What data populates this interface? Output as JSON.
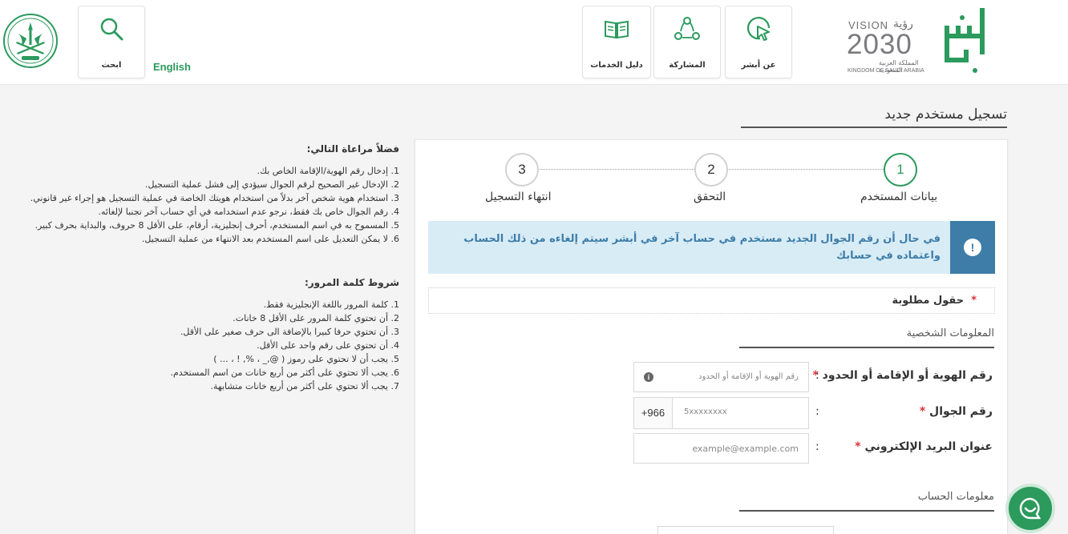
{
  "header": {
    "search_label": "ابحث",
    "language_label": "English",
    "services_guide_label": "دليل الخدمات",
    "participation_label": "المشاركة",
    "about_label": "عن أبشر",
    "vision": {
      "word": "VISION",
      "arabic_word": "رؤية",
      "year": "2030",
      "kingdom_ar": "المملكة العربية السعودية",
      "kingdom_en": "KINGDOM OF SAUDI ARABIA"
    },
    "brand_color": "#2b9a5c"
  },
  "page": {
    "title": "تسجيل مستخدم جديد"
  },
  "notes": {
    "title": "فضلاً مراعاة التالي:",
    "items": [
      "1. إدخال رقم الهوية/الإقامة الخاص بك.",
      "2. الإدخال غير الصحيح لرقم الجوال سيؤدي إلى فشل عملية التسجيل.",
      "3. استخدام هوية شخص آخر بدلاً من استخدام هويتك الخاصة في عملية التسجيل هو إجراء غير قانوني.",
      "4. رقم الجوال خاص بك فقط، نرجو عدم استخدامه في أي حساب آخر تجنبا لإلغائه.",
      "5. المسموح به في اسم المستخدم، أحرف إنجليزية، أرقام، على الأقل 8 حروف، والبداية بحرف كبير.",
      "6. لا يمكن التعديل على اسم المستخدم بعد الانتهاء من عملية التسجيل."
    ]
  },
  "password_rules": {
    "title": "شروط كلمة المرور:",
    "items": [
      "1. كلمة المرور باللغة الإنجليزية فقط.",
      "2. أن تحتوي كلمة المرور على الأقل 8 خانات.",
      "3. أن تحتوي حرفا كبيرا بالإضافة الى حرف صغير على الأقل.",
      "4. أن تحتوي على رقم واحد على الأقل.",
      "5. يجب أن لا تحتوي على رموز ( @,_ ، %, ! ، ... )",
      "6. يجب ألا تحتوي على أكثر من أربع خانات من اسم المستخدم.",
      "7. يجب ألا تحتوي على أكثر من أربع خانات متشابهة."
    ]
  },
  "steps": [
    {
      "number": "1",
      "label": "بيانات المستخدم",
      "active": true
    },
    {
      "number": "2",
      "label": "التحقق",
      "active": false
    },
    {
      "number": "3",
      "label": "انتهاء التسجيل",
      "active": false
    }
  ],
  "alert": {
    "icon": "exclamation-icon",
    "text": "في حال أن رقم الجوال الجديد مستخدم في حساب آخر في أبشر سيتم إلغاءه من ذلك الحساب واعتماده في حسابك",
    "color": "#3d7da8",
    "background": "#d8ecf6"
  },
  "required_note": {
    "star": "*",
    "text": "حقول مطلوبة"
  },
  "personal_info": {
    "title": "المعلومات الشخصية",
    "id_label": "رقم الهوية أو الإقامة أو الحدود",
    "id_placeholder": "رقم الهوية أو الإقامة أو الحدود",
    "mobile_label": "رقم الجوال",
    "mobile_prefix": "+966",
    "mobile_placeholder": "5xxxxxxxx",
    "email_label": "عنوان البريد الإلكتروني",
    "email_placeholder": "example@example.com",
    "star": "*",
    "colon": ":"
  },
  "account_info": {
    "title": "معلومات الحساب"
  }
}
